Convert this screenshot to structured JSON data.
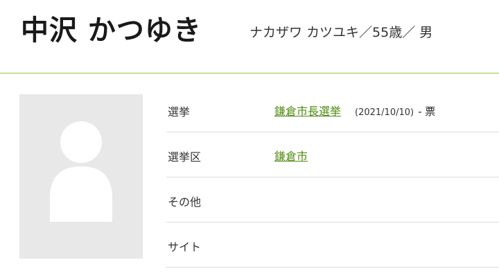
{
  "profile": {
    "name": "中沢 かつゆき",
    "subtitle": "ナカザワ カツユキ／55歳／ 男"
  },
  "info": {
    "election": {
      "label": "選挙",
      "value": "鎌倉市長選挙",
      "date": "(2021/10/10)",
      "votes": "- 票"
    },
    "district": {
      "label": "選挙区",
      "value": "鎌倉市"
    },
    "other": {
      "label": "その他"
    },
    "site": {
      "label": "サイト"
    }
  },
  "colors": {
    "accent": "#8cc63f",
    "link": "#4f8a10",
    "avatar_bg": "#e8e8e8"
  }
}
